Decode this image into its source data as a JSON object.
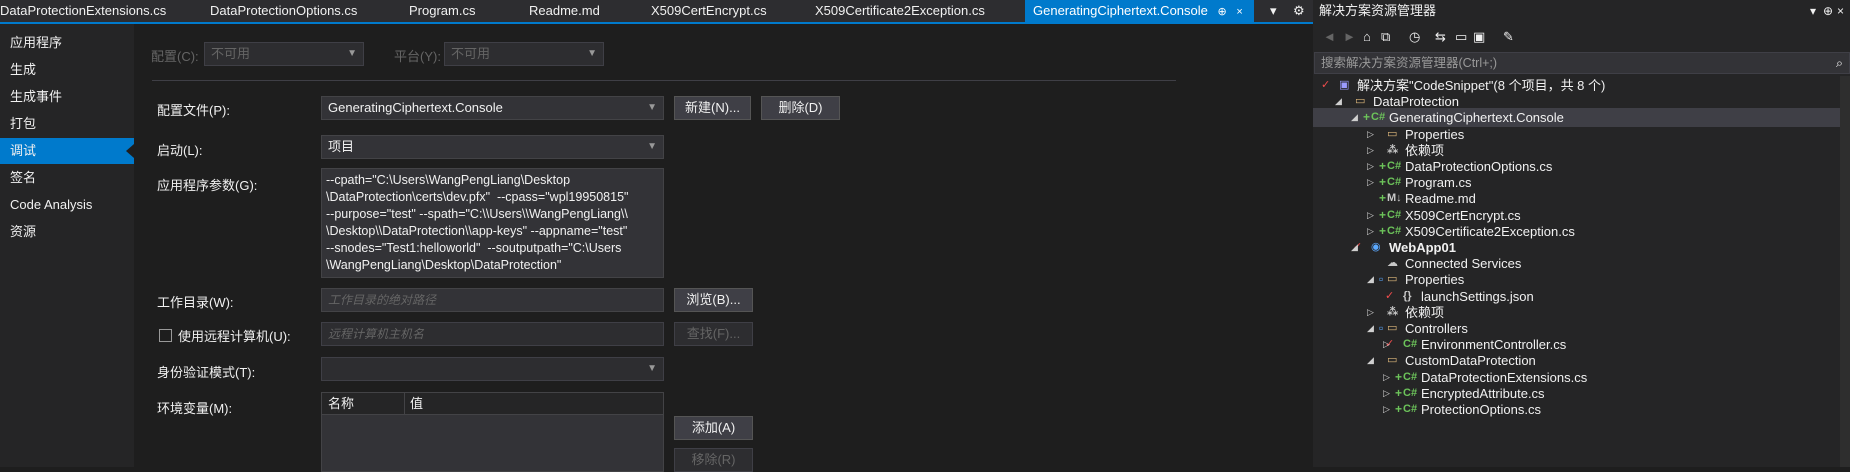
{
  "tabs": [
    {
      "label": "DataProtectionExtensions.cs"
    },
    {
      "label": "DataProtectionOptions.cs"
    },
    {
      "label": "Program.cs"
    },
    {
      "label": "Readme.md"
    },
    {
      "label": "X509CertEncrypt.cs"
    },
    {
      "label": "X509Certificate2Exception.cs"
    },
    {
      "label": "GeneratingCiphertext.Console",
      "active": true
    }
  ],
  "tab_pin_glyph": "⊕",
  "tab_close_glyph": "×",
  "tab_overflow_glyph": "▾",
  "tab_settings_glyph": "⚙",
  "left_nav": [
    {
      "label": "应用程序"
    },
    {
      "label": "生成"
    },
    {
      "label": "生成事件"
    },
    {
      "label": "打包"
    },
    {
      "label": "调试",
      "active": true
    },
    {
      "label": "签名"
    },
    {
      "label": "Code Analysis"
    },
    {
      "label": "资源"
    }
  ],
  "config": {
    "config_label": "配置(C):",
    "config_value": "不可用",
    "platform_label": "平台(Y):",
    "platform_value": "不可用"
  },
  "profile": {
    "label": "配置文件(P):",
    "value": "GeneratingCiphertext.Console",
    "new_button": "新建(N)...",
    "delete_button": "删除(D)"
  },
  "launch": {
    "label": "启动(L):",
    "value": "项目"
  },
  "app_args": {
    "label": "应用程序参数(G):",
    "value": "--cpath=\"C:\\Users\\WangPengLiang\\Desktop\n\\DataProtection\\certs\\dev.pfx\"  --cpass=\"wpl19950815\"\n--purpose=\"test\" --spath=\"C:\\\\Users\\\\WangPengLiang\\\\\n\\Desktop\\\\DataProtection\\\\app-keys\" --appname=\"test\"\n--snodes=\"Test1:helloworld\"  --soutputpath=\"C:\\Users\n\\WangPengLiang\\Desktop\\DataProtection\""
  },
  "working_dir": {
    "label": "工作目录(W):",
    "placeholder": "工作目录的绝对路径",
    "browse_button": "浏览(B)..."
  },
  "remote": {
    "label": "使用远程计算机(U):",
    "placeholder": "远程计算机主机名",
    "find_button": "查找(F)...",
    "checked": false
  },
  "auth": {
    "label": "身份验证模式(T):"
  },
  "env": {
    "label": "环境变量(M):",
    "col_name": "名称",
    "col_value": "值",
    "add_button": "添加(A)",
    "remove_button": "移除(R)"
  },
  "solution_explorer": {
    "title": "解决方案资源管理器",
    "title_icons": {
      "dropdown": "▾",
      "pin": "⊕",
      "close": "×"
    },
    "search_placeholder": "搜索解决方案资源管理器(Ctrl+;)",
    "search_icon": "⌕",
    "toolbar_glyphs": {
      "back": "◄",
      "forward": "►",
      "home": "⌂",
      "pending": "◷",
      "sync": "⇆",
      "collapse": "▭",
      "show_all": "▣",
      "props": "✎",
      "preview": "⧉"
    },
    "tree": [
      {
        "label": "解决方案\"CodeSnippet\"(8 个项目，共 8 个)",
        "indent": 0,
        "icon": "▣",
        "icon_color": "proj",
        "check": true
      },
      {
        "label": "DataProtection",
        "indent": 1,
        "expander": "◢",
        "icon": "▭",
        "icon_color": "folder"
      },
      {
        "label": "GeneratingCiphertext.Console",
        "indent": 2,
        "expander": "◢",
        "plus": true,
        "icon": "C#",
        "icon_color": "cs",
        "selected": true
      },
      {
        "label": "Properties",
        "indent": 3,
        "expander": "▷",
        "icon": "▭",
        "icon_color": "folder"
      },
      {
        "label": "依赖项",
        "indent": 3,
        "expander": "▷",
        "icon": "⁂",
        "icon_color": "gray"
      },
      {
        "label": "DataProtectionOptions.cs",
        "indent": 3,
        "expander": "▷",
        "plus": true,
        "icon": "C#",
        "icon_color": "cs"
      },
      {
        "label": "Program.cs",
        "indent": 3,
        "expander": "▷",
        "plus": true,
        "icon": "C#",
        "icon_color": "cs"
      },
      {
        "label": "Readme.md",
        "indent": 3,
        "plus": true,
        "icon": "M↓",
        "icon_color": "gray"
      },
      {
        "label": "X509CertEncrypt.cs",
        "indent": 3,
        "expander": "▷",
        "plus": true,
        "icon": "C#",
        "icon_color": "cs"
      },
      {
        "label": "X509Certificate2Exception.cs",
        "indent": 3,
        "expander": "▷",
        "plus": true,
        "icon": "C#",
        "icon_color": "cs"
      },
      {
        "label": "WebApp01",
        "indent": 2,
        "expander": "◢",
        "check": true,
        "icon": "◉",
        "icon_color": "blue",
        "bold": true
      },
      {
        "label": "Connected Services",
        "indent": 3,
        "icon": "☁",
        "icon_color": "gray"
      },
      {
        "label": "Properties",
        "indent": 3,
        "expander": "◢",
        "lock": true,
        "icon": "▭",
        "icon_color": "folder"
      },
      {
        "label": "launchSettings.json",
        "indent": 4,
        "check": true,
        "icon": "{}",
        "icon_color": "gray"
      },
      {
        "label": "依赖项",
        "indent": 3,
        "expander": "▷",
        "icon": "⁂",
        "icon_color": "gray"
      },
      {
        "label": "Controllers",
        "indent": 3,
        "expander": "◢",
        "lock": true,
        "icon": "▭",
        "icon_color": "folder"
      },
      {
        "label": "EnvironmentController.cs",
        "indent": 4,
        "expander": "▷",
        "check": true,
        "icon": "C#",
        "icon_color": "cs"
      },
      {
        "label": "CustomDataProtection",
        "indent": 3,
        "expander": "◢",
        "icon": "▭",
        "icon_color": "folder"
      },
      {
        "label": "DataProtectionExtensions.cs",
        "indent": 4,
        "expander": "▷",
        "plus": true,
        "icon": "C#",
        "icon_color": "cs"
      },
      {
        "label": "EncryptedAttribute.cs",
        "indent": 4,
        "expander": "▷",
        "plus": true,
        "icon": "C#",
        "icon_color": "cs"
      },
      {
        "label": "ProtectionOptions.cs",
        "indent": 4,
        "expander": "▷",
        "plus": true,
        "icon": "C#",
        "icon_color": "cs"
      }
    ]
  }
}
